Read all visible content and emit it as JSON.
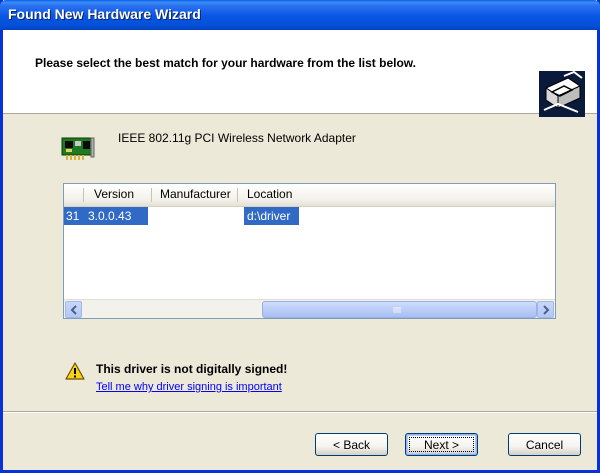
{
  "window": {
    "title": "Found New Hardware Wizard"
  },
  "header": {
    "instruction": "Please select the best match for your hardware from the list below."
  },
  "device": {
    "name": "IEEE 802.11g PCI Wireless Network Adapter",
    "icon": "network-card-icon"
  },
  "driver_list": {
    "columns": [
      "Version",
      "Manufacturer",
      "Location"
    ],
    "rows": [
      {
        "name_fragment": "31",
        "version": "3.0.0.43",
        "manufacturer": "",
        "location": "d:\\driver",
        "selected": true
      }
    ]
  },
  "warning": {
    "icon": "warning-icon",
    "title": "This driver is not digitally signed!",
    "link": "Tell me why driver signing is important"
  },
  "buttons": {
    "back": "< Back",
    "next": "Next >",
    "cancel": "Cancel"
  },
  "colors": {
    "titlebar": "#0856e3",
    "selection": "#316ac5",
    "link": "#0000ff",
    "dialog_bg": "#ece9d8"
  }
}
